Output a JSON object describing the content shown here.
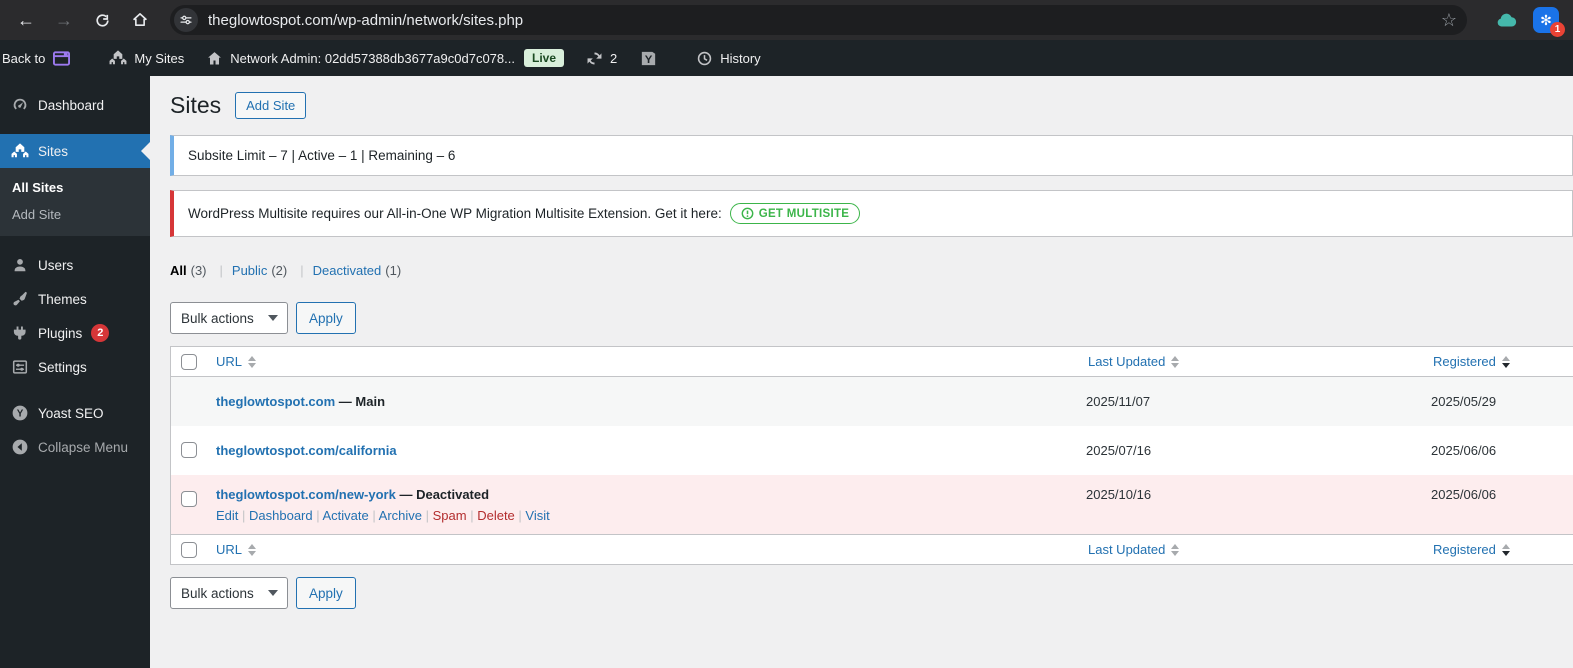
{
  "browser": {
    "url": "theglowtospot.com/wp-admin/network/sites.php",
    "profile_badge": "1"
  },
  "admin_bar": {
    "back_to_label": "Back to",
    "my_sites_label": "My Sites",
    "network_admin_label": "Network Admin: 02dd57388db3677a9c0d7c078...",
    "live_badge": "Live",
    "update_count": "2",
    "history_label": "History"
  },
  "sidebar": {
    "items": [
      {
        "label": "Dashboard"
      },
      {
        "label": "Sites"
      },
      {
        "label": "All Sites"
      },
      {
        "label": "Add Site"
      },
      {
        "label": "Users"
      },
      {
        "label": "Themes"
      },
      {
        "label": "Plugins",
        "badge": "2"
      },
      {
        "label": "Settings"
      },
      {
        "label": "Yoast SEO"
      },
      {
        "label": "Collapse Menu"
      }
    ]
  },
  "page": {
    "title": "Sites",
    "add_site_button": "Add Site",
    "subsite_notice": "Subsite Limit – 7 | Active – 1 | Remaining – 6",
    "multisite_notice": "WordPress Multisite requires our All-in-One WP Migration Multisite Extension. Get it here:",
    "get_multisite_button": "GET MULTISITE",
    "bulk_actions_label": "Bulk actions",
    "apply_label": "Apply"
  },
  "filters": [
    {
      "label": "All",
      "count": "(3)"
    },
    {
      "label": "Public",
      "count": "(2)"
    },
    {
      "label": "Deactivated",
      "count": "(1)"
    }
  ],
  "table": {
    "columns": {
      "url": "URL",
      "last_updated": "Last Updated",
      "registered": "Registered"
    },
    "rows": [
      {
        "url": "theglowtospot.com",
        "status_suffix": "— Main",
        "last_updated": "2025/11/07",
        "registered": "2025/05/29"
      },
      {
        "url": "theglowtospot.com/california",
        "status_suffix": "",
        "last_updated": "2025/07/16",
        "registered": "2025/06/06"
      },
      {
        "url": "theglowtospot.com/new-york",
        "status_suffix": "— Deactivated",
        "last_updated": "2025/10/16",
        "registered": "2025/06/06",
        "actions": [
          {
            "label": "Edit"
          },
          {
            "label": "Dashboard"
          },
          {
            "label": "Activate"
          },
          {
            "label": "Archive"
          },
          {
            "label": "Spam"
          },
          {
            "label": "Delete"
          },
          {
            "label": "Visit"
          }
        ]
      }
    ]
  },
  "colors": {
    "accent_blue": "#2271b1",
    "notice_blue": "#72aee6",
    "notice_red": "#d63638",
    "plugin_badge_red": "#d63638",
    "get_multisite_green": "#3cb54a",
    "live_badge_bg": "#d9efdb",
    "live_badge_text": "#1b4a22",
    "deactivated_row_bg": "#fdedee",
    "alt_row_bg": "#f6f7f7",
    "sidebar_bg": "#1d2327"
  }
}
